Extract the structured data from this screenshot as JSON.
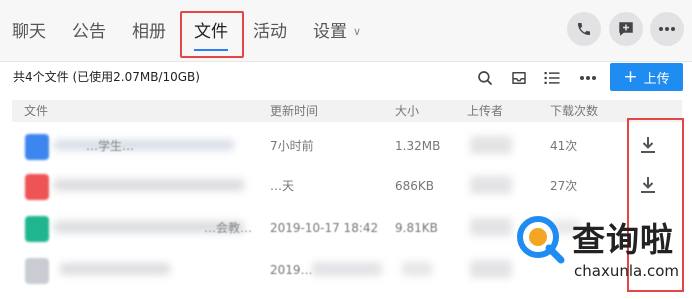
{
  "tabs": [
    {
      "label": "聊天"
    },
    {
      "label": "公告"
    },
    {
      "label": "相册"
    },
    {
      "label": "文件",
      "active": true
    },
    {
      "label": "活动"
    },
    {
      "label": "设置"
    }
  ],
  "header_icons": [
    "phone-icon",
    "chat-add-icon",
    "more-icon"
  ],
  "toolbar": {
    "summary": "共4个文件 (已使用2.07MB/10GB)",
    "icons": [
      "search-icon",
      "inbox-icon",
      "list-view-icon",
      "more-icon"
    ],
    "upload_label": "上传"
  },
  "table": {
    "headers": [
      "文件",
      "更新时间",
      "大小",
      "上传者",
      "下载次数"
    ],
    "rows": [
      {
        "name": "…学生…",
        "time": "7小时前",
        "size": "1.32MB",
        "downloads": "41次",
        "icon_color": "#3d86ef",
        "download_icon": true
      },
      {
        "name": "",
        "time": "…天",
        "size": "686KB",
        "downloads": "27次",
        "icon_color": "#ee5356",
        "download_icon": true
      },
      {
        "name": "…会教…",
        "time": "2019-10-17 18:42",
        "size": "9.81KB",
        "downloads": "",
        "icon_color": "#1fb68f",
        "download_icon": false
      },
      {
        "name": "",
        "time": "2019…",
        "size": "",
        "downloads": "",
        "icon_color": "#c9ccd3",
        "download_icon": false
      }
    ]
  },
  "watermark": {
    "title": "查询啦",
    "url": "chaxunla.com"
  },
  "colors": {
    "accent": "#1e8cf0",
    "highlight": "#e54545"
  }
}
